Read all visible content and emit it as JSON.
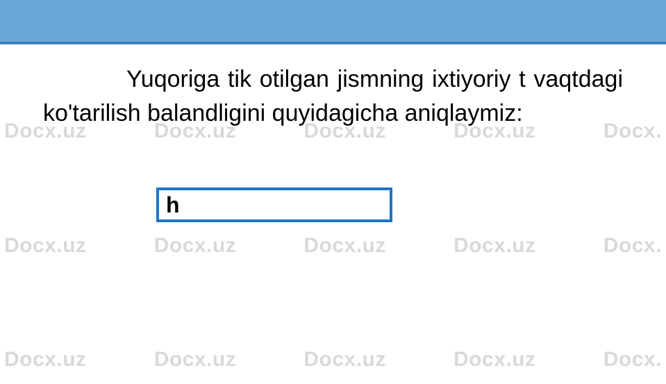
{
  "watermark": "Docx.uz",
  "watermark_partial": "Docx.",
  "header": {
    "accent_color": "#6aa5d9",
    "border_color": "#3b7fbc"
  },
  "body_text": "Yuqoriga tik otilgan jismning ixtiyoriy t vaqtdagi  ko'tarilish balandligini quyidagicha aniqlaymiz:",
  "formula_label": "h",
  "colors": {
    "box_border": "#1f74c5",
    "text": "#000000",
    "watermark": "#d9d9d9"
  }
}
